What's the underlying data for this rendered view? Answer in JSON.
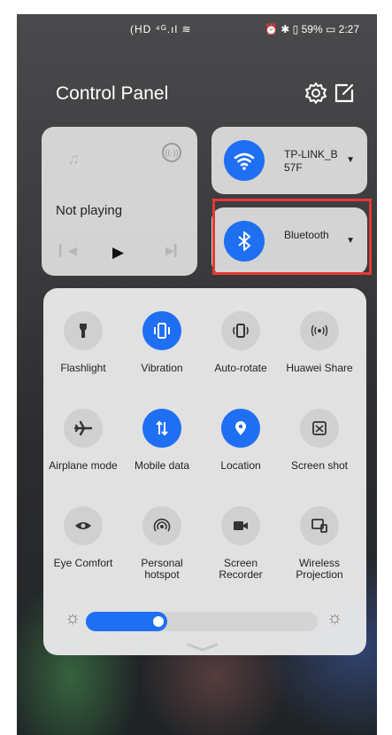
{
  "status_bar": {
    "left_icons": "(HD ⁴ᴳ.ıl ≋",
    "right_icons": "⏰ ✱ ▯ 59% ▭ 2:27"
  },
  "header": {
    "title": "Control Panel"
  },
  "media": {
    "status": "Not playing"
  },
  "wifi": {
    "label": "TP-LINK_B57F"
  },
  "bluetooth": {
    "label": "Bluetooth"
  },
  "toggles": [
    {
      "label": "Flashlight",
      "icon": "flashlight-icon",
      "on": false
    },
    {
      "label": "Vibration",
      "icon": "vibration-icon",
      "on": true
    },
    {
      "label": "Auto-rotate",
      "icon": "auto-rotate-icon",
      "on": false
    },
    {
      "label": "Huawei Share",
      "icon": "huawei-share-icon",
      "on": false
    },
    {
      "label": "Airplane mode",
      "icon": "airplane-icon",
      "on": false
    },
    {
      "label": "Mobile data",
      "icon": "mobile-data-icon",
      "on": true
    },
    {
      "label": "Location",
      "icon": "location-icon",
      "on": true
    },
    {
      "label": "Screen shot",
      "icon": "screenshot-icon",
      "on": false
    },
    {
      "label": "Eye Comfort",
      "icon": "eye-comfort-icon",
      "on": false
    },
    {
      "label": "Personal hotspot",
      "icon": "hotspot-icon",
      "on": false
    },
    {
      "label": "Screen Recorder",
      "icon": "screen-recorder-icon",
      "on": false
    },
    {
      "label": "Wireless Projection",
      "icon": "wireless-projection-icon",
      "on": false
    }
  ],
  "brightness": {
    "level": 0.35
  },
  "colors": {
    "accent": "#1f6ff3",
    "highlight": "#e53935"
  }
}
